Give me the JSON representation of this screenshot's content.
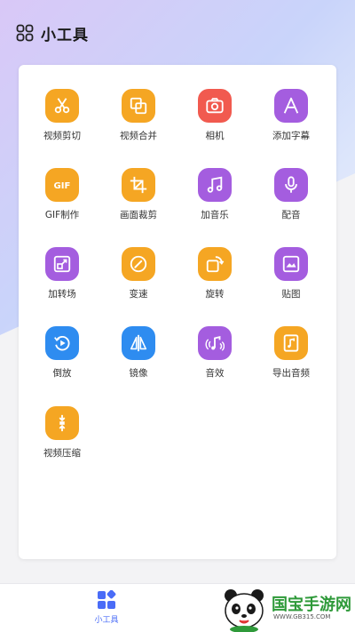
{
  "header": {
    "title": "小工具",
    "icon": "apps-grid-icon"
  },
  "colors": {
    "orange": "#f5a623",
    "red": "#f15a4f",
    "purple": "#a45ddf",
    "blue": "#2e8cf0",
    "active_tab": "#4a6cf7"
  },
  "tools": [
    {
      "label": "视频剪切",
      "icon": "scissors-icon"
    },
    {
      "label": "视频合并",
      "icon": "merge-icon"
    },
    {
      "label": "相机",
      "icon": "camera-icon"
    },
    {
      "label": "添加字幕",
      "icon": "subtitle-icon"
    },
    {
      "label": "GIF制作",
      "icon": "gif-icon"
    },
    {
      "label": "画面裁剪",
      "icon": "crop-icon"
    },
    {
      "label": "加音乐",
      "icon": "music-note-icon"
    },
    {
      "label": "配音",
      "icon": "microphone-icon"
    },
    {
      "label": "加转场",
      "icon": "transition-icon"
    },
    {
      "label": "变速",
      "icon": "speed-icon"
    },
    {
      "label": "旋转",
      "icon": "rotate-icon"
    },
    {
      "label": "贴图",
      "icon": "sticker-icon"
    },
    {
      "label": "倒放",
      "icon": "reverse-play-icon"
    },
    {
      "label": "镜像",
      "icon": "mirror-icon"
    },
    {
      "label": "音效",
      "icon": "sound-effect-icon"
    },
    {
      "label": "导出音频",
      "icon": "export-audio-icon"
    },
    {
      "label": "视频压缩",
      "icon": "compress-icon"
    }
  ],
  "tabbar": {
    "tabs": [
      {
        "label": "小工具",
        "icon": "tools-grid-icon",
        "active": true
      }
    ]
  },
  "watermark": {
    "text": "国宝手游网",
    "url": "WWW.GB315.COM",
    "icon": "panda-icon"
  }
}
